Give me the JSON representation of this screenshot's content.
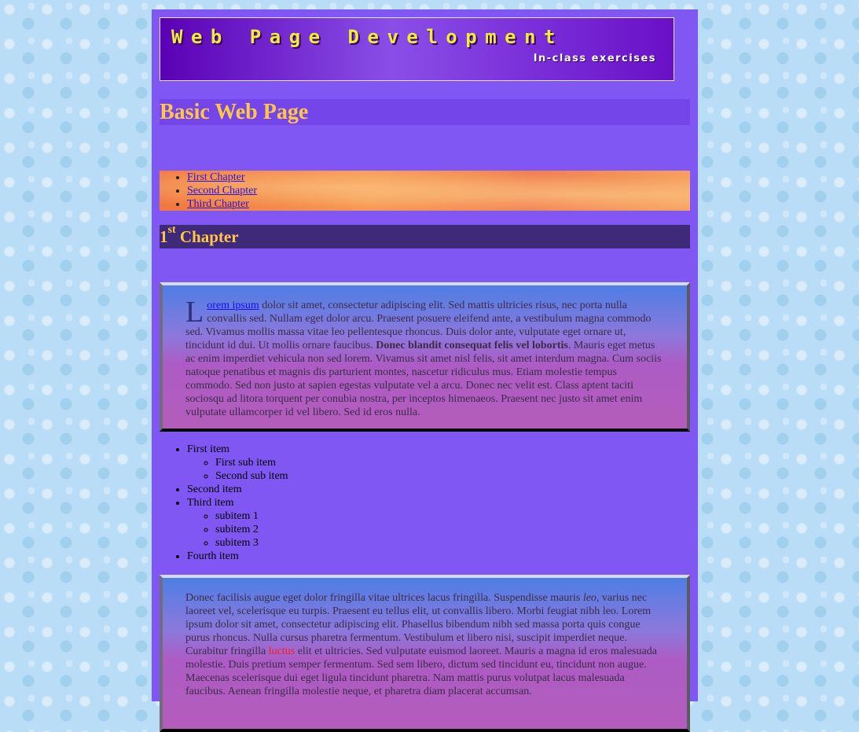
{
  "banner": {
    "title": "Web Page Development",
    "subtitle": "In-class exercises"
  },
  "page_heading": "Basic Web Page",
  "nav": {
    "links": [
      "First Chapter",
      "Second Chapter",
      "Third Chapter"
    ]
  },
  "chapter": {
    "number": "1",
    "suffix": "st",
    "label": " Chapter"
  },
  "panel1": {
    "dropcap": "L",
    "link": "orem ipsum",
    "text_a": " dolor sit amet, consectetur adipiscing elit. Sed mattis ultricies risus, nec porta nulla convallis sed. Nullam eget dolor arcu. Praesent posuere eleifend ante, a vestibulum magna commodo sed. Vivamus mollis massa vitae leo pellentesque rhoncus. Duis dolor ante, vulputate eget ornare ut, tincidunt id dui. Ut mollis ornare faucibus. ",
    "bold": "Donec blandit consequat felis vel lobortis",
    "text_b": ". Mauris eget metus ac enim imperdiet vehicula non sed lorem. Vivamus sit amet nisl felis, sit amet interdum magna. Cum sociis natoque penatibus et magnis dis parturient montes, nascetur ridiculus mus. Etiam molestie tempus commodo. Sed non justo at sapien egestas vulputate vel a arcu. Donec nec velit est. Class aptent taciti sociosqu ad litora torquent per conubia nostra, per inceptos himenaeos. Praesent nec justo sit amet enim vulputate ullamcorper id vel libero. Sed id eros nulla."
  },
  "list": {
    "items": [
      {
        "label": "First item",
        "sub": [
          "First sub item",
          "Second sub item"
        ]
      },
      {
        "label": "Second item",
        "sub": []
      },
      {
        "label": "Third item",
        "sub": [
          "subitem 1",
          "subitem 2",
          "subitem 3"
        ]
      },
      {
        "label": "Fourth item",
        "sub": []
      }
    ]
  },
  "panel2": {
    "text_a": "Donec facilisis augue eget dolor fringilla vitae ultrices lacus fringilla. Suspendisse mauris ",
    "italic": "leo",
    "text_b": ", varius nec laoreet vel, scelerisque eu turpis. Praesent eu tellus elit, ut convallis libero. Morbi feugiat nibh leo. Lorem ipsum dolor sit amet, consectetur adipiscing elit. Phasellus bibendum nibh sed massa porta quis congue purus rhoncus. Nulla cursus pharetra fermentum. Vestibulum et libero nisi, suscipit imperdiet neque. Curabitur fringilla ",
    "red": "luctus",
    "text_c": " elit et ultricies. Sed vulputate euismod laoreet. Mauris a magna id eros malesuada molestie. Duis pretium semper fermentum. Sed sem libero, dictum sed tincidunt eu, tincidunt non augue. Maecenas scelerisque dui eget ligula tincidunt pharetra. Nam mattis purus volutpat lacus malesuada faucibus. Aenean fringilla molestie neque, et pharetra diam placerat accumsan."
  },
  "colors": {
    "page_bg": "#8157f3",
    "heading_text": "#ffc649",
    "chapter_bar": "#3e2a78",
    "link": "#2a12d8"
  }
}
